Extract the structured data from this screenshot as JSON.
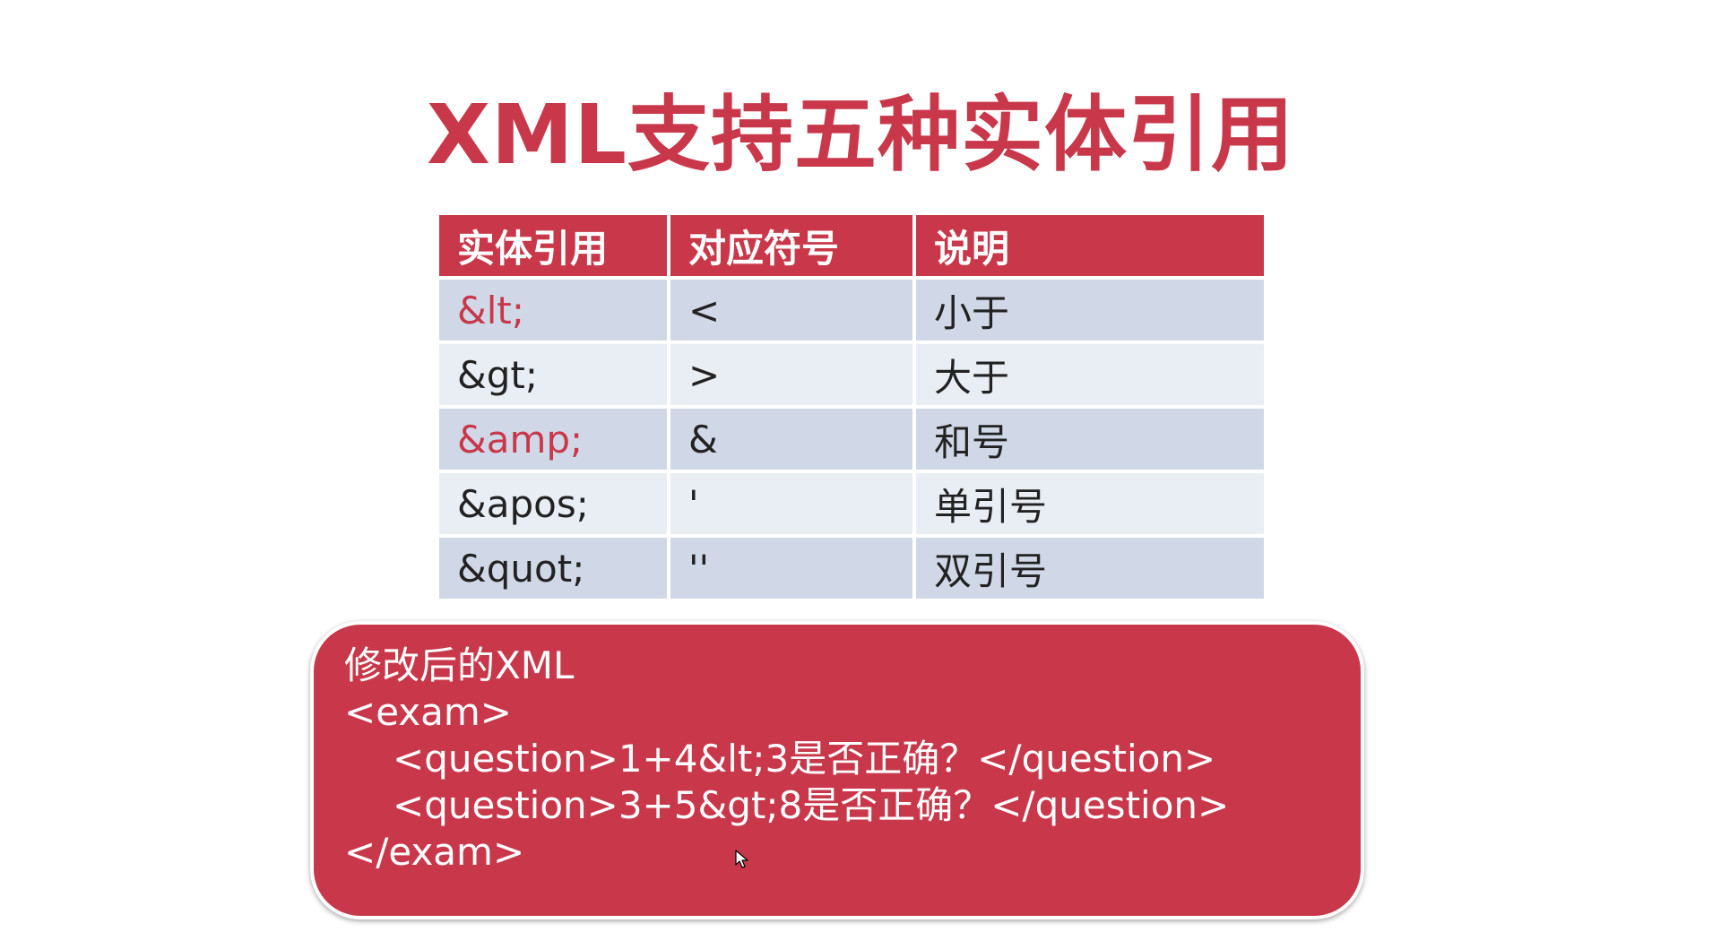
{
  "slide": {
    "title": "XML支持五种实体引用"
  },
  "table": {
    "headers": [
      "实体引用",
      "对应符号",
      "说明"
    ],
    "rows": [
      {
        "entity": "&lt;",
        "symbol": "<",
        "desc": "小于"
      },
      {
        "entity": "&gt;",
        "symbol": ">",
        "desc": "大于"
      },
      {
        "entity": "&amp;",
        "symbol": "&",
        "desc": "和号"
      },
      {
        "entity": "&apos;",
        "symbol": "'",
        "desc": "单引号"
      },
      {
        "entity": "&quot;",
        "symbol": "''",
        "desc": "双引号"
      }
    ]
  },
  "code_box": {
    "lines": [
      "修改后的XML",
      "<exam>",
      "<question>1+4&lt;3是否正确？</question>",
      "<question>3+5&gt;8是否正确？</question>",
      "</exam>"
    ]
  },
  "colors": {
    "accent": "#c8384a",
    "row_dark": "#d0d8e8",
    "row_light": "#e9edf4",
    "text": "#222222"
  },
  "icons": {
    "cursor": "mouse-pointer-icon"
  }
}
